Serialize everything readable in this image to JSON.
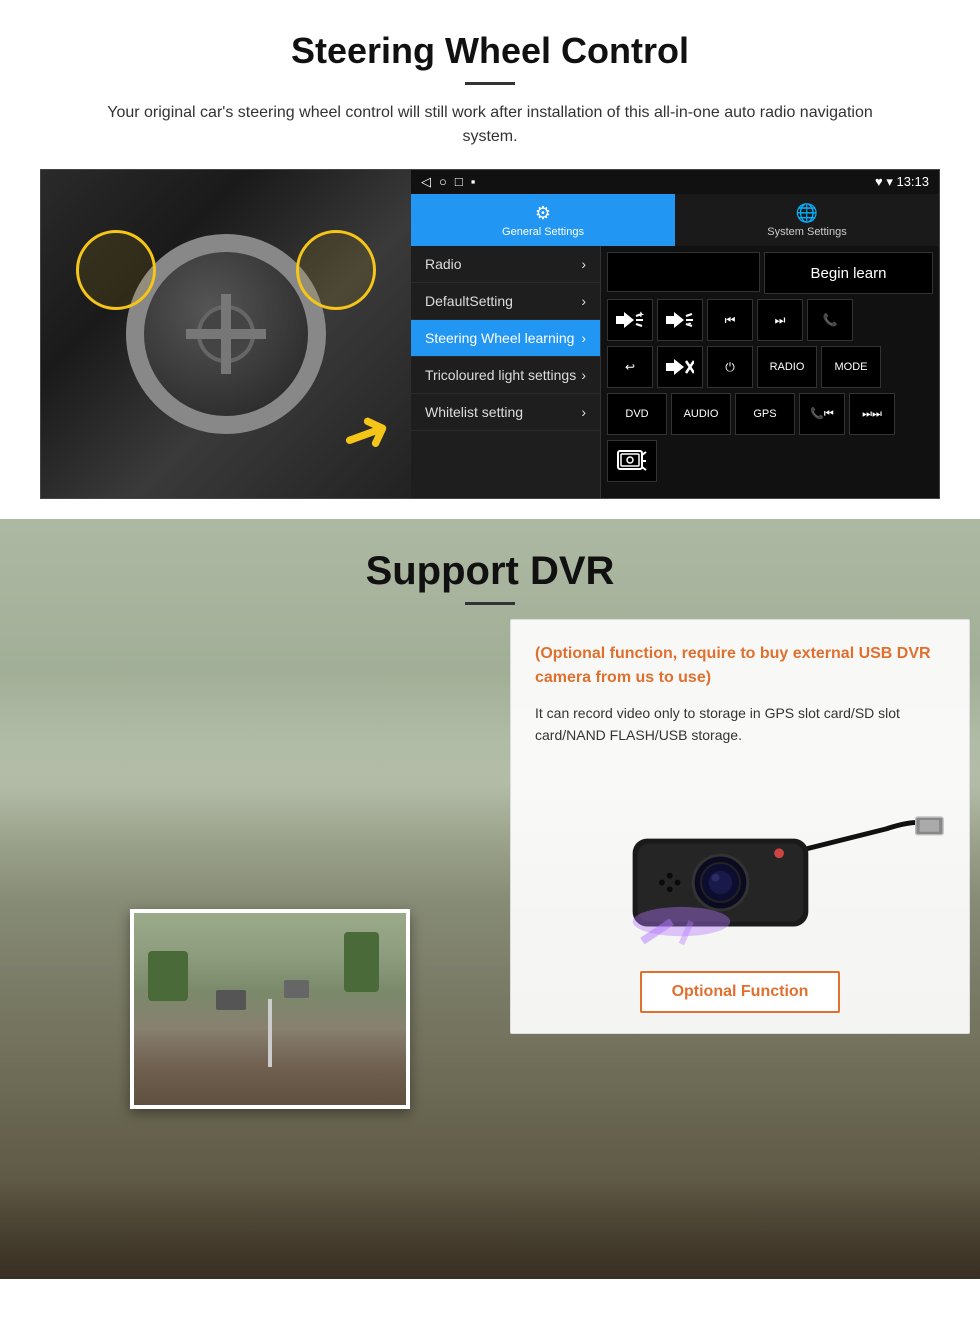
{
  "steering": {
    "title": "Steering Wheel Control",
    "subtitle": "Your original car's steering wheel control will still work after installation of this all-in-one auto radio navigation system.",
    "statusbar": {
      "left_icons": [
        "◁",
        "○",
        "□",
        "▪"
      ],
      "right": "♥ ▾ 13:13"
    },
    "tabs": [
      {
        "label": "General Settings",
        "icon": "⚙",
        "active": true
      },
      {
        "label": "System Settings",
        "icon": "🌐",
        "active": false
      }
    ],
    "menu_items": [
      {
        "label": "Radio",
        "active": false
      },
      {
        "label": "DefaultSetting",
        "active": false
      },
      {
        "label": "Steering Wheel learning",
        "active": true
      },
      {
        "label": "Tricoloured light settings",
        "active": false
      },
      {
        "label": "Whitelist setting",
        "active": false
      }
    ],
    "begin_learn": "Begin learn",
    "control_buttons": [
      [
        "⏮+",
        "⏮-",
        "⏮⏮",
        "⏭⏭",
        "📞"
      ],
      [
        "↩",
        "🔇×",
        "⏻",
        "RADIO",
        "MODE"
      ],
      [
        "DVD",
        "AUDIO",
        "GPS",
        "📞⏮",
        "⏭⏭"
      ],
      [
        "⏺"
      ]
    ]
  },
  "dvr": {
    "title": "Support DVR",
    "optional_text": "(Optional function, require to buy external USB DVR camera from us to use)",
    "desc_text": "It can record video only to storage in GPS slot card/SD slot card/NAND FLASH/USB storage.",
    "optional_fn_btn": "Optional Function"
  }
}
